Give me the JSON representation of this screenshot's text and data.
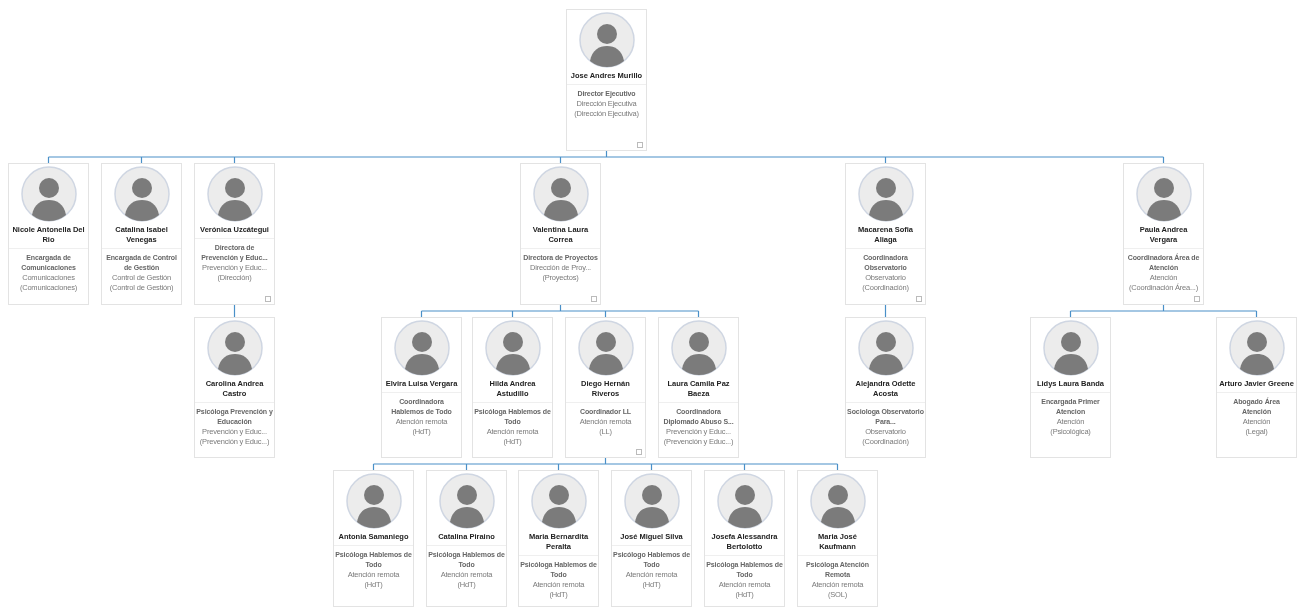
{
  "org_chart": {
    "name": "Jose Andres Murillo",
    "title": "Director Ejecutivo",
    "department": "Dirección Ejecutiva",
    "group": "(Dirección Ejecutiva)",
    "children": [
      {
        "name": "Nicole Antonella Del Rio",
        "title": "Encargada de Comunicaciones",
        "department": "Comunicaciones",
        "group": "(Comunicaciones)"
      },
      {
        "name": "Catalina Isabel Venegas",
        "title": "Encargada de Control de Gestión",
        "department": "Control de Gestión",
        "group": "(Control de Gestión)"
      },
      {
        "name": "Verónica Uzcátegui",
        "title": "Directora de Prevención y Educ...",
        "department": "Prevención y Educ...",
        "group": "(Dirección)",
        "children": [
          {
            "name": "Carolina Andrea Castro",
            "title": "Psicóloga Prevención y Educación",
            "department": "Prevención y Educ...",
            "group": "(Prevención y Educ...)"
          }
        ]
      },
      {
        "name": "Valentina Laura Correa",
        "title": "Directora de Proyectos",
        "department": "Dirección de Proy...",
        "group": "(Proyectos)",
        "children": [
          {
            "name": "Elvira Luisa Vergara",
            "title": "Coordinadora Hablemos de Todo",
            "department": "Atención remota",
            "group": "(HdT)"
          },
          {
            "name": "Hilda Andrea Astudillo",
            "title": "Psicóloga Hablemos de Todo",
            "department": "Atención remota",
            "group": "(HdT)"
          },
          {
            "name": "Diego Hernán Riveros",
            "title": "Coordinador LL",
            "department": "Atención remota",
            "group": "(LL)",
            "children": [
              {
                "name": "Antonia Samaniego",
                "title": "Psicóloga Hablemos de Todo",
                "department": "Atención remota",
                "group": "(HdT)"
              },
              {
                "name": "Catalina Piraino",
                "title": "Psicóloga Hablemos de Todo",
                "department": "Atención remota",
                "group": "(HdT)"
              },
              {
                "name": "Maria Bernardita Peralta",
                "title": "Psicóloga Hablemos de Todo",
                "department": "Atención remota",
                "group": "(HdT)"
              },
              {
                "name": "José Miguel Silva",
                "title": "Psicólogo Hablemos de Todo",
                "department": "Atención remota",
                "group": "(HdT)"
              },
              {
                "name": "Josefa Alessandra Bertolotto",
                "title": "Psicóloga Hablemos de Todo",
                "department": "Atención remota",
                "group": "(HdT)"
              },
              {
                "name": "Maria José Kaufmann",
                "title": "Psicóloga Atención Remota",
                "department": "Atención remota",
                "group": "(SOL)"
              }
            ]
          },
          {
            "name": "Laura Camila Paz Baeza",
            "title": "Coordinadora Diplomado Abuso S...",
            "department": "Prevención y Educ...",
            "group": "(Prevención y Educ...)"
          }
        ]
      },
      {
        "name": "Macarena Sofia Aliaga",
        "title": "Coordinadora Observatorio",
        "department": "Observatorio",
        "group": "(Coordinación)",
        "children": [
          {
            "name": "Alejandra Odette Acosta",
            "title": "Sociologa Observatorio Para...",
            "department": "Observatorio",
            "group": "(Coordinación)"
          }
        ]
      },
      {
        "name": "Paula Andrea Vergara",
        "title": "Coordinadora Área de Atención",
        "department": "Atención",
        "group": "(Coordinación Área...)",
        "children": [
          {
            "name": "Lidys Laura Banda",
            "title": "Encargada Primer Atencion",
            "department": "Atención",
            "group": "(Psicológica)"
          },
          {
            "name": "Arturo Javier Greene",
            "title": "Abogado Área Atención",
            "department": "Atención",
            "group": "(Legal)"
          }
        ]
      }
    ]
  }
}
